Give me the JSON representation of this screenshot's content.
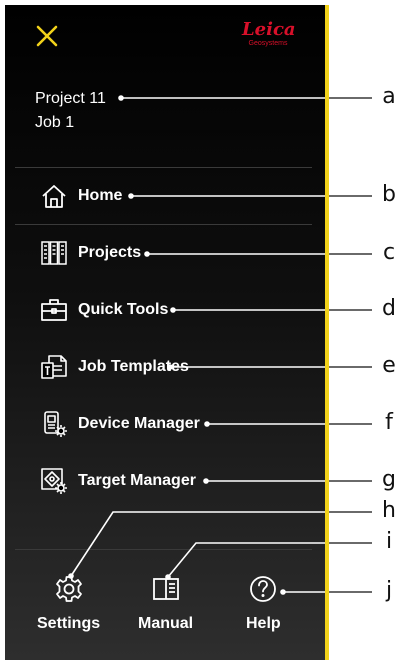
{
  "header": {
    "close_icon": "close-icon",
    "logo_brand": "Leica",
    "logo_sub": "Geosystems"
  },
  "context": {
    "project": "Project 11",
    "job": "Job 1"
  },
  "menu": [
    {
      "label": "Home",
      "icon": "home-icon"
    },
    {
      "label": "Projects",
      "icon": "projects-icon"
    },
    {
      "label": "Quick Tools",
      "icon": "toolbox-icon"
    },
    {
      "label": "Job Templates",
      "icon": "job-template-icon"
    },
    {
      "label": "Device Manager",
      "icon": "device-manager-icon"
    },
    {
      "label": "Target Manager",
      "icon": "target-manager-icon"
    }
  ],
  "bottom": [
    {
      "label": "Settings",
      "icon": "gear-icon"
    },
    {
      "label": "Manual",
      "icon": "manual-icon"
    },
    {
      "label": "Help",
      "icon": "help-icon"
    }
  ],
  "callouts": [
    "a",
    "b",
    "c",
    "d",
    "e",
    "f",
    "g",
    "h",
    "i",
    "j"
  ],
  "colors": {
    "accent": "#f2d21a",
    "brand": "#d8102a",
    "panel": "#000000"
  }
}
